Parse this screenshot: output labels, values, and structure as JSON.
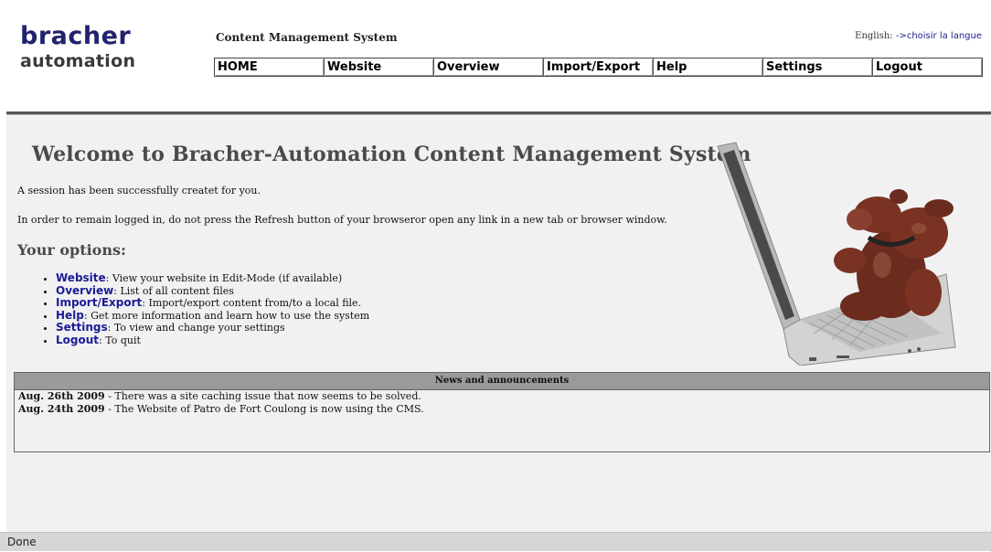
{
  "header": {
    "logo_line1": "bracher",
    "logo_line2": "automation",
    "cms_title": "Content Management System",
    "lang_label": "English:",
    "lang_link": "->choisir la langue"
  },
  "nav": [
    "HOME",
    "Website",
    "Overview",
    "Import/Export",
    "Help",
    "Settings",
    "Logout"
  ],
  "main": {
    "welcome": "Welcome to Bracher-Automation Content Management System",
    "session_msg": "A session has been successfully createt for you.",
    "warning_msg": "In order to remain logged in, do not press the Refresh button of your browseror open any link in a new tab or browser window.",
    "options_heading": "Your options:",
    "options": [
      {
        "label": "Website",
        "desc": ": View your website in Edit-Mode (if available)"
      },
      {
        "label": "Overview",
        "desc": ": List of all content files"
      },
      {
        "label": "Import/Export",
        "desc": ": Import/export content from/to a local file."
      },
      {
        "label": "Help",
        "desc": ": Get more information and learn how to use the system"
      },
      {
        "label": "Settings",
        "desc": ": To view and change your settings"
      },
      {
        "label": "Logout",
        "desc": ": To quit"
      }
    ]
  },
  "news": {
    "heading": "News and announcements",
    "items": [
      {
        "date": "Aug. 26th 2009",
        "text": " - There was a site caching issue that now seems to be solved."
      },
      {
        "date": "Aug. 24th 2009",
        "text": " - The Website of Patro de Fort Coulong is now using the CMS."
      }
    ]
  },
  "status": "Done",
  "colors": {
    "brand": "#22226e",
    "link": "#1b1b98",
    "news_header": "#9a9a9a",
    "status_bar": "#d6d6d6"
  }
}
